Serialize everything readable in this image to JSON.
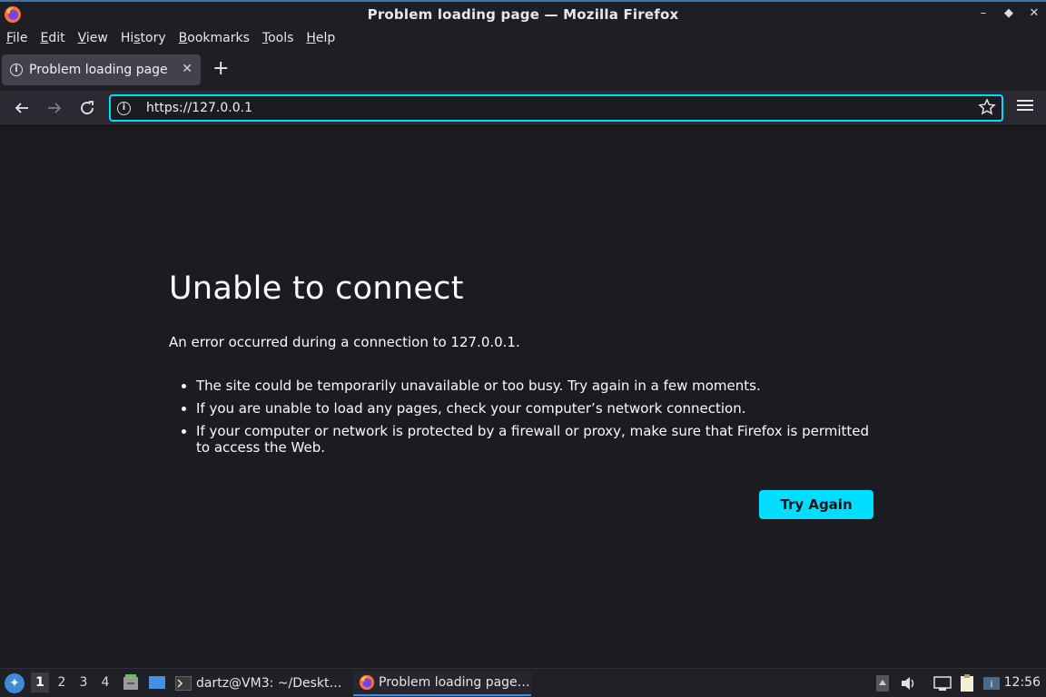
{
  "window": {
    "title": "Problem loading page — Mozilla Firefox",
    "controls": [
      "–",
      "◆",
      "✕"
    ]
  },
  "menubar": {
    "items": [
      {
        "label": "File",
        "key": "F",
        "rest": "ile"
      },
      {
        "label": "Edit",
        "key": "E",
        "rest": "dit"
      },
      {
        "label": "View",
        "key": "V",
        "rest": "iew"
      },
      {
        "label": "History",
        "pre": "Hi",
        "key": "s",
        "rest": "tory"
      },
      {
        "label": "Bookmarks",
        "key": "B",
        "rest": "ookmarks"
      },
      {
        "label": "Tools",
        "key": "T",
        "rest": "ools"
      },
      {
        "label": "Help",
        "key": "H",
        "rest": "elp"
      }
    ]
  },
  "tab": {
    "label": "Problem loading page",
    "close": "✕",
    "new_tab": "+"
  },
  "navbar": {
    "url": "https://127.0.0.1"
  },
  "error_page": {
    "heading": "Unable to connect",
    "description": "An error occurred during a connection to 127.0.0.1.",
    "bullets": [
      "The site could be temporarily unavailable or too busy. Try again in a few moments.",
      "If you are unable to load any pages, check your computer’s network connection.",
      "If your computer or network is protected by a firewall or proxy, make sure that Firefox is permitted to access the Web."
    ],
    "button": "Try Again"
  },
  "taskbar": {
    "workspaces": [
      "1",
      "2",
      "3",
      "4"
    ],
    "active_workspace": "1",
    "tasks": [
      {
        "label": "dartz@VM3: ~/Deskt…",
        "icon": "terminal-icon"
      },
      {
        "label": "Problem loading page…",
        "icon": "firefox-icon"
      }
    ],
    "clock": "12:56"
  },
  "colors": {
    "accent": "#00ddff",
    "content_bg": "#1c1b22",
    "toolbar_bg": "#2b2a33"
  }
}
